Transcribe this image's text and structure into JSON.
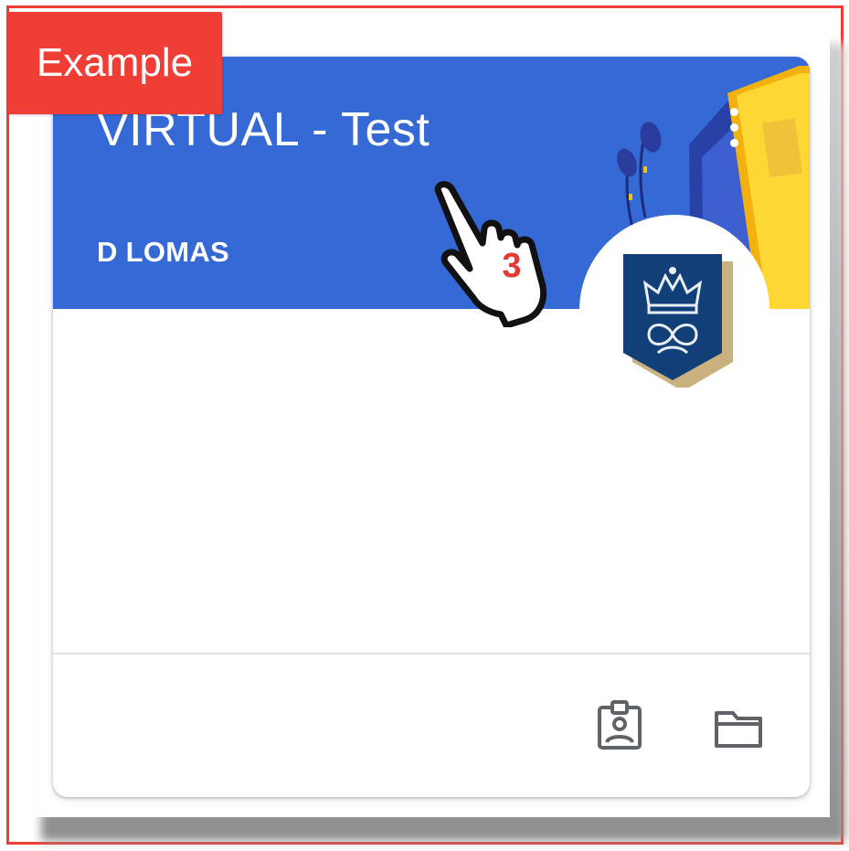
{
  "callout": {
    "label": "Example"
  },
  "class_card": {
    "title": "VIRTUAL - Test",
    "teacher": "D LOMAS",
    "banner_color": "#3469d6",
    "menu_icon": "more-vert-icon",
    "avatar_icon": "crest-icon",
    "footer_icons": [
      "assignment-ind-icon",
      "folder-icon"
    ]
  },
  "annotation": {
    "step_number": "3",
    "icon": "hand-pointer-icon",
    "color": "#f03d36"
  }
}
